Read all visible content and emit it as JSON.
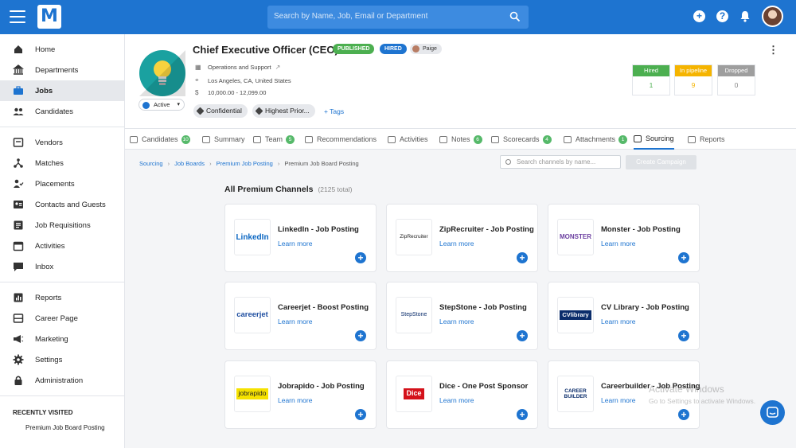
{
  "topbar": {
    "logo": "M",
    "search_placeholder": "Search by Name, Job, Email or Department"
  },
  "sidebar": {
    "groups": [
      [
        {
          "label": "Home",
          "icon": "home-icon"
        },
        {
          "label": "Departments",
          "icon": "building-icon"
        },
        {
          "label": "Jobs",
          "icon": "briefcase-icon",
          "active": true
        },
        {
          "label": "Candidates",
          "icon": "people-icon"
        }
      ],
      [
        {
          "label": "Vendors",
          "icon": "vendor-icon"
        },
        {
          "label": "Matches",
          "icon": "match-icon"
        },
        {
          "label": "Placements",
          "icon": "placement-icon"
        },
        {
          "label": "Contacts and Guests",
          "icon": "contact-card-icon"
        },
        {
          "label": "Job Requisitions",
          "icon": "requisition-icon"
        },
        {
          "label": "Activities",
          "icon": "calendar-icon"
        },
        {
          "label": "Inbox",
          "icon": "inbox-icon"
        }
      ],
      [
        {
          "label": "Reports",
          "icon": "chart-icon"
        },
        {
          "label": "Career Page",
          "icon": "career-page-icon"
        },
        {
          "label": "Marketing",
          "icon": "megaphone-icon"
        },
        {
          "label": "Settings",
          "icon": "gear-icon"
        },
        {
          "label": "Administration",
          "icon": "lock-icon"
        }
      ]
    ],
    "recent_title": "RECENTLY VISITED",
    "recent_items": [
      "Premium Job Board Posting"
    ]
  },
  "job": {
    "title": "Chief Executive Officer (CEO)",
    "status_badge": "PUBLISHED",
    "hired_badge": "HIRED",
    "owner": "Paige",
    "department": "Operations and Support",
    "location": "Los Angeles, CA, United States",
    "salary": "10,000.00 - 12,099.00",
    "state": "Active",
    "chips": [
      "Confidential",
      "Highest Prior..."
    ],
    "tags_link": "+ Tags"
  },
  "stats": [
    {
      "label": "Hired",
      "value": "1",
      "color": "#4caf50",
      "text_color": "#4caf50"
    },
    {
      "label": "In pipeline",
      "value": "9",
      "color": "#f5b400",
      "text_color": "#f5b400"
    },
    {
      "label": "Dropped",
      "value": "0",
      "color": "#9e9e9e",
      "text_color": "#888888"
    }
  ],
  "tabs": [
    {
      "label": "Candidates",
      "count": "10"
    },
    {
      "label": "Summary",
      "count": ""
    },
    {
      "label": "Team",
      "count": "5"
    },
    {
      "label": "Recommendations",
      "count": ""
    },
    {
      "label": "Activities",
      "count": ""
    },
    {
      "label": "Notes",
      "count": "6"
    },
    {
      "label": "Scorecards",
      "count": "4"
    },
    {
      "label": "Attachments",
      "count": "1"
    },
    {
      "label": "Sourcing",
      "count": "",
      "active": true
    },
    {
      "label": "Reports",
      "count": ""
    }
  ],
  "breadcrumb": [
    "Sourcing",
    "Job Boards",
    "Premium Job Posting",
    "Premium Job Board Posting"
  ],
  "channel_search_placeholder": "Search channels by name...",
  "create_campaign": "Create Campaign",
  "section": {
    "title": "All Premium Channels",
    "total": "(2125 total)"
  },
  "channels": [
    {
      "name": "LinkedIn - Job Posting",
      "logo": "LinkedIn",
      "learn": "Learn more"
    },
    {
      "name": "ZipRecruiter - Job Posting",
      "logo": "ZipRecruiter",
      "learn": "Learn more"
    },
    {
      "name": "Monster - Job Posting",
      "logo": "MONSTER",
      "learn": "Learn more"
    },
    {
      "name": "Careerjet - Boost Posting",
      "logo": "careerjet",
      "learn": "Learn more"
    },
    {
      "name": "StepStone - Job Posting",
      "logo": "StepStone",
      "learn": "Learn more"
    },
    {
      "name": "CV Library - Job Posting",
      "logo": "CVlibrary",
      "learn": "Learn more"
    },
    {
      "name": "Jobrapido - Job Posting",
      "logo": "jobrapido",
      "learn": "Learn more"
    },
    {
      "name": "Dice - One Post Sponsor",
      "logo": "Dice",
      "learn": "Learn more"
    },
    {
      "name": "Careerbuilder - Job Posting",
      "logo": "CAREER BUILDER",
      "learn": "Learn more"
    }
  ],
  "watermark": {
    "title": "Activate Windows",
    "subtitle": "Go to Settings to activate Windows."
  },
  "colors": {
    "brand": "#1e74d0",
    "count_badge": "#56b96a"
  }
}
